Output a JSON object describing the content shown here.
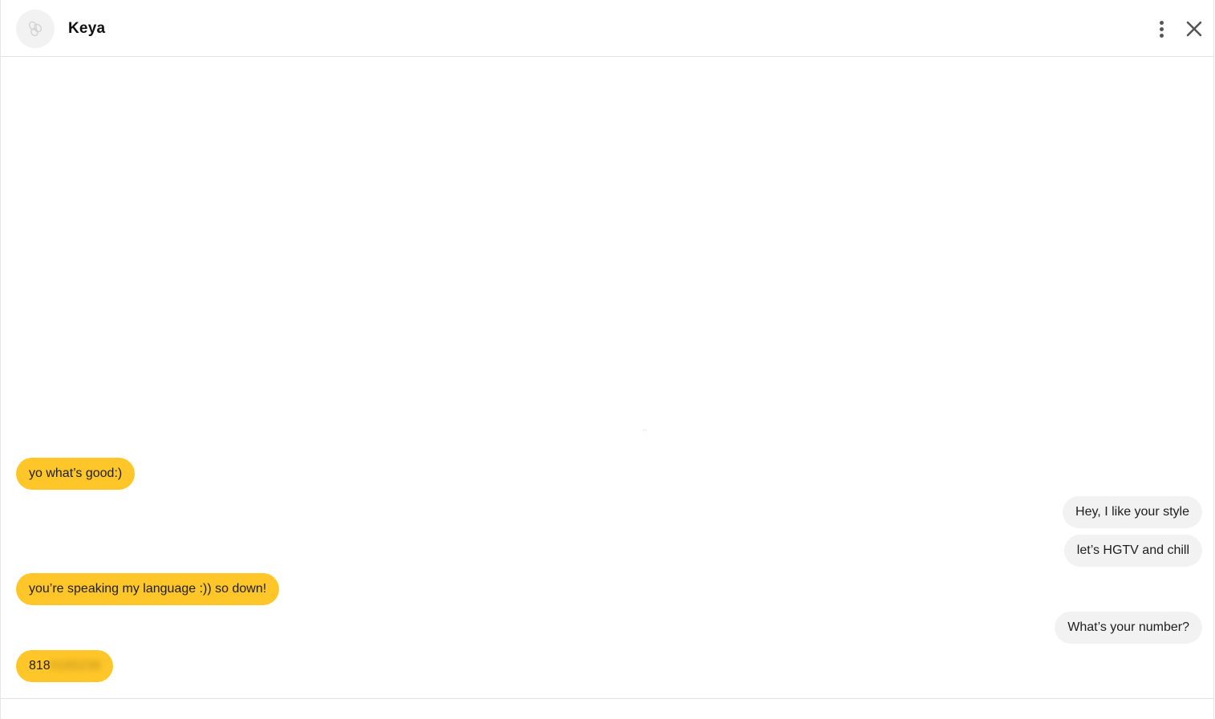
{
  "header": {
    "contact_name": "Keya",
    "avatar_icon": "bee-logo-icon",
    "more_icon": "more-vertical-icon",
    "close_icon": "close-icon"
  },
  "messages": [
    {
      "sender": "them",
      "text": "yo what’s good:)"
    },
    {
      "sender": "me",
      "text": "Hey, I like your style"
    },
    {
      "sender": "me",
      "text": "let’s HGTV and chill"
    },
    {
      "sender": "them",
      "text": "you’re speaking my language :)) so down!"
    },
    {
      "sender": "me",
      "text": "What’s your number?"
    },
    {
      "sender": "them",
      "text_visible": "818",
      "text_obscured": "0165239"
    }
  ],
  "colors": {
    "their_bubble": "#ffc629",
    "my_bubble": "#f2f2f2",
    "divider": "#e3e3e3"
  }
}
